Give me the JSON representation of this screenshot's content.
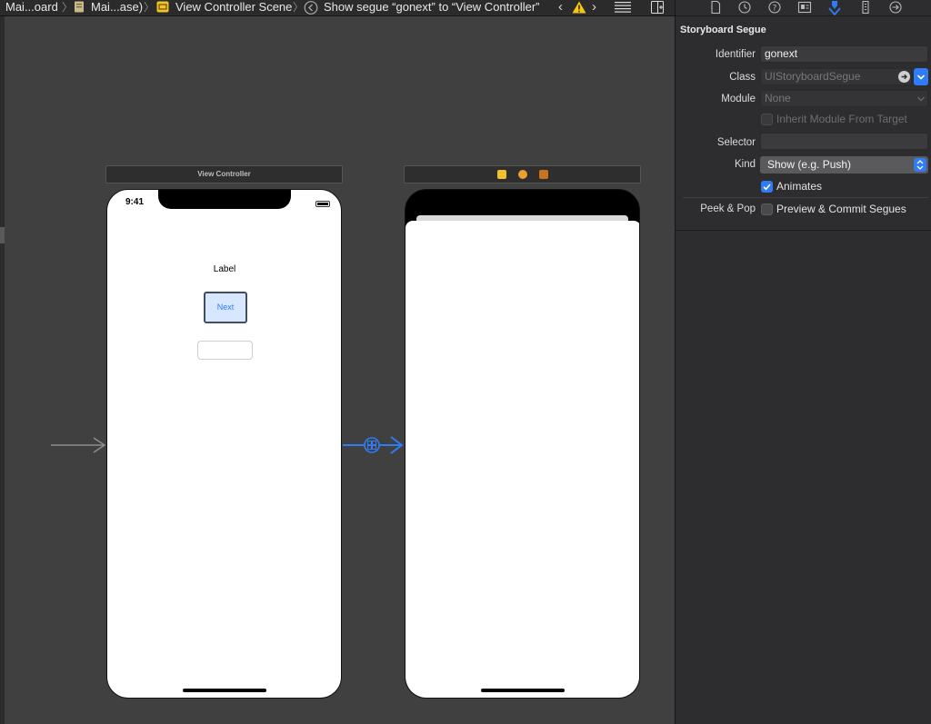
{
  "jump_bar": {
    "crumbs": [
      "Mai...oard",
      "Mai...ase)",
      "View Controller Scene",
      "Show segue “gonext” to “View Controller”"
    ],
    "icons": [
      "storyboard-file-icon",
      "storyboard-file-icon",
      "scene-icon",
      "segue-icon",
      "back-arrow-icon",
      "warning-icon",
      "forward-arrow-icon",
      "lines-icon",
      "add-editor-icon"
    ]
  },
  "canvas": {
    "scene1": {
      "title": "View Controller",
      "status_time": "9:41",
      "label_text": "Label",
      "button_text": "Next"
    },
    "scene2": {
      "dock_icons": [
        "view-controller-icon",
        "first-responder-icon",
        "exit-icon"
      ]
    },
    "segue_icon": "segue-badge-icon",
    "colors": {
      "canvas": "#404040",
      "segue": "#2f7cf6",
      "button_fill": "#d7e7ff"
    }
  },
  "inspector": {
    "tab_icons": [
      "file-inspector-icon",
      "history-icon",
      "help-icon",
      "identity-icon",
      "attributes-icon",
      "size-icon",
      "connections-icon"
    ],
    "section_title": "Storyboard Segue",
    "identifier": {
      "label": "Identifier",
      "value": "gonext"
    },
    "class": {
      "label": "Class",
      "placeholder": "UIStoryboardSegue"
    },
    "module": {
      "label": "Module",
      "placeholder": "None"
    },
    "inherit_module": {
      "label": "Inherit Module From Target",
      "checked": false
    },
    "selector": {
      "label": "Selector",
      "value": ""
    },
    "kind": {
      "label": "Kind",
      "value": "Show (e.g. Push)"
    },
    "animates": {
      "label": "Animates",
      "checked": true
    },
    "peek_pop": {
      "label": "Peek & Pop",
      "option": "Preview & Commit Segues",
      "checked": false
    },
    "accent": "#2f7cf6"
  }
}
